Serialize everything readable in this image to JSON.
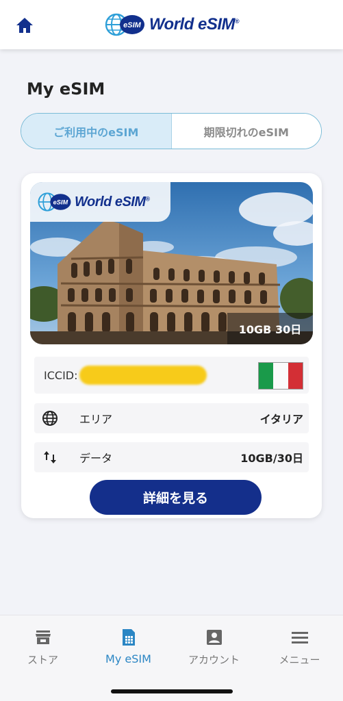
{
  "header": {
    "brand_name": "World eSIM",
    "brand_badge": "eSIM",
    "brand_mark": "®"
  },
  "page": {
    "title": "My eSIM"
  },
  "tabs": [
    {
      "label": "ご利用中のeSIM",
      "active": true
    },
    {
      "label": "期限切れのeSIM",
      "active": false
    }
  ],
  "esim_card": {
    "brand_name": "World eSIM",
    "brand_badge": "eSIM",
    "brand_mark": "®",
    "plan_badge": "10GB 30日",
    "iccid_label": "ICCID:",
    "flag": "italy-flag",
    "area": {
      "label": "エリア",
      "value": "イタリア",
      "icon": "globe-icon"
    },
    "data": {
      "label": "データ",
      "value": "10GB/30日",
      "icon": "swap-arrows-icon"
    },
    "detail_button": "詳細を見る"
  },
  "bottom_nav": [
    {
      "label": "ストア",
      "icon": "store-icon",
      "active": false
    },
    {
      "label": "My eSIM",
      "icon": "sim-card-icon",
      "active": true
    },
    {
      "label": "アカウント",
      "icon": "account-icon",
      "active": false
    },
    {
      "label": "メニュー",
      "icon": "menu-icon",
      "active": false
    }
  ],
  "colors": {
    "brand_navy": "#142f8b",
    "active_tab_bg": "#d9ecf8",
    "active_tab_text": "#5da6d3",
    "active_nav": "#2b86c4"
  }
}
